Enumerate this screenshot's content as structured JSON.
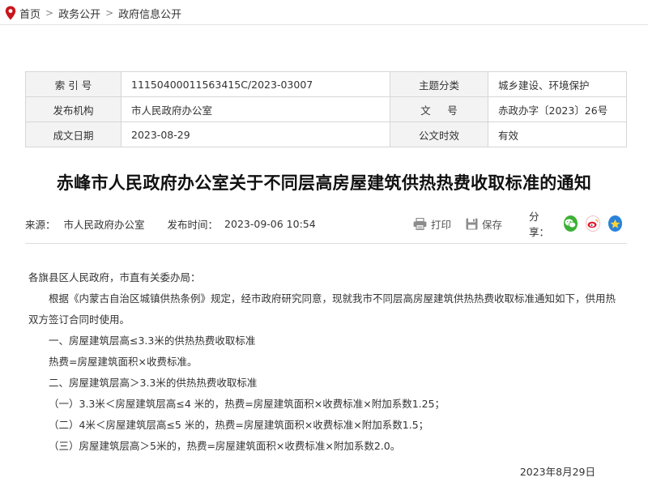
{
  "breadcrumb": {
    "items": [
      "首页",
      "政务公开",
      "政府信息公开"
    ],
    "separator": ">"
  },
  "meta": {
    "rows": [
      {
        "label1": "索 引 号",
        "value1": "11150400011563415C/2023-03007",
        "label2": "主题分类",
        "value2": "城乡建设、环境保护"
      },
      {
        "label1": "发布机构",
        "value1": "市人民政府办公室",
        "label2": "文 　 号",
        "value2": "赤政办字〔2023〕26号"
      },
      {
        "label1": "成文日期",
        "value1": "2023-08-29",
        "label2": "公文时效",
        "value2": "有效"
      }
    ]
  },
  "article": {
    "title": "赤峰市人民政府办公室关于不同层高房屋建筑供热热费收取标准的通知",
    "source_label": "来源：",
    "source": "市人民政府办公室",
    "time_label": "发布时间：",
    "time": "2023-09-06 10:54",
    "print_label": "打印",
    "save_label": "保存",
    "share_label": "分享：",
    "share_icons": [
      "wechat-icon",
      "weibo-icon",
      "qzone-icon"
    ],
    "paragraphs": [
      "各旗县区人民政府，市直有关委办局：",
      "根据《内蒙古自治区城镇供热条例》规定，经市政府研究同意，现就我市不同层高房屋建筑供热热费收取标准通知如下，供用热双方签订合同时使用。",
      "一、房屋建筑层高≤3.3米的供热热费收取标准",
      "热费=房屋建筑面积×收费标准。",
      "二、房屋建筑层高＞3.3米的供热热费收取标准",
      "（一）3.3米＜房屋建筑层高≤4 米的，热费=房屋建筑面积×收费标准×附加系数1.25；",
      "（二）4米＜房屋建筑层高≤5 米的，热费=房屋建筑面积×收费标准×附加系数1.5；",
      "（三）房屋建筑层高＞5米的，热费=房屋建筑面积×收费标准×附加系数2.0。"
    ],
    "date": "2023年8月29日"
  },
  "colors": {
    "accent": "#c8161d",
    "wechat": "#3cb034",
    "weibo": "#e6162d",
    "qzone": "#2b82d9"
  }
}
